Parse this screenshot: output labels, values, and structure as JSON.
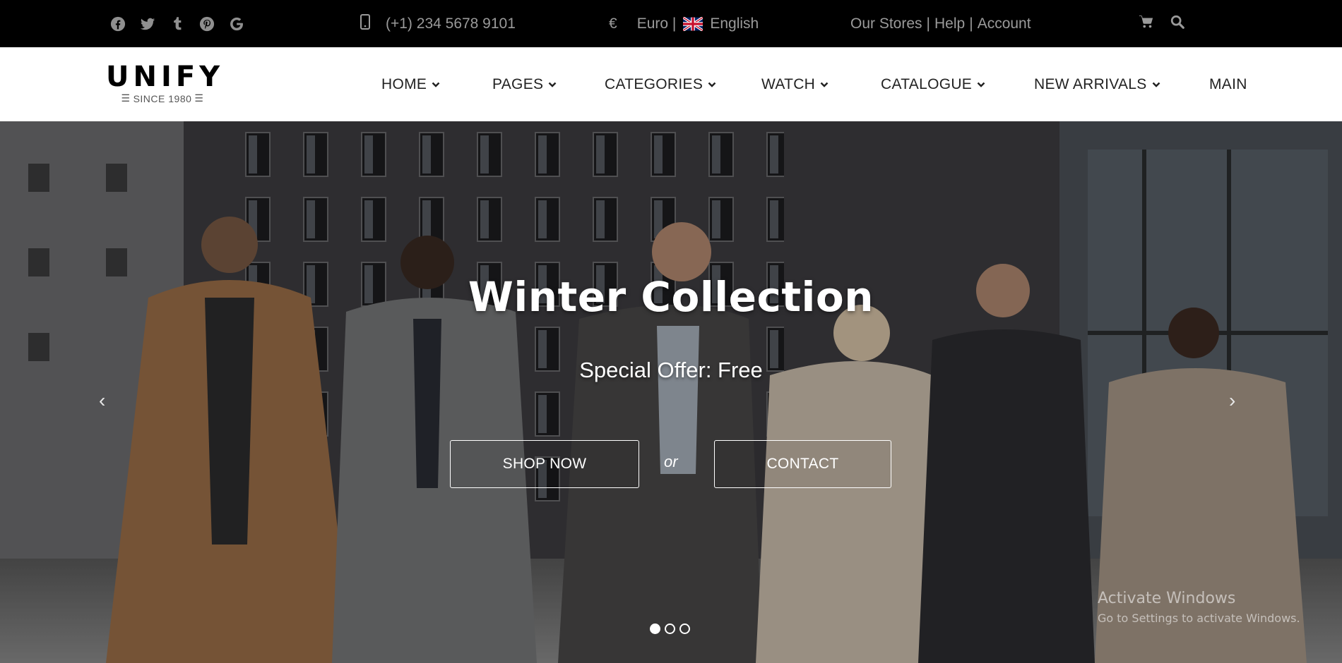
{
  "topbar": {
    "social_icons": [
      "facebook-icon",
      "twitter-icon",
      "tumblr-icon",
      "pinterest-icon",
      "google-icon"
    ],
    "phone": "(+1) 234 5678 9101",
    "currency_symbol": "€",
    "currency": "Euro |",
    "language": "English",
    "links": [
      "Our Stores",
      "|",
      "Help",
      "|",
      "Account"
    ],
    "tool_icons": [
      "cart-icon",
      "search-icon"
    ]
  },
  "logo": {
    "brand": "UNIFY",
    "tagline": "SINCE 1980"
  },
  "nav": {
    "items": [
      {
        "label": "HOME",
        "dropdown": true
      },
      {
        "label": "PAGES",
        "dropdown": true
      },
      {
        "label": "CATEGORIES",
        "dropdown": true
      },
      {
        "label": "WATCH",
        "dropdown": true
      },
      {
        "label": "CATALOGUE",
        "dropdown": true
      },
      {
        "label": "NEW ARRIVALS",
        "dropdown": true
      },
      {
        "label": "MAIN",
        "dropdown": false
      }
    ]
  },
  "hero": {
    "title": "Winter Collection",
    "subtitle": "Special Offer: Free",
    "shop_button": "SHOP NOW",
    "or_text": "or",
    "contact_button": "CONTACT",
    "prev_arrow": "‹",
    "next_arrow": "›",
    "slides_total": 3,
    "slide_active": 1
  },
  "watermark": {
    "line1": "Activate Windows",
    "line2": "Go to Settings to activate Windows."
  },
  "colors": {
    "topbar_bg": "#000000",
    "topbar_text": "#9a9a9a",
    "header_bg": "#ffffff",
    "nav_text": "#222222"
  }
}
